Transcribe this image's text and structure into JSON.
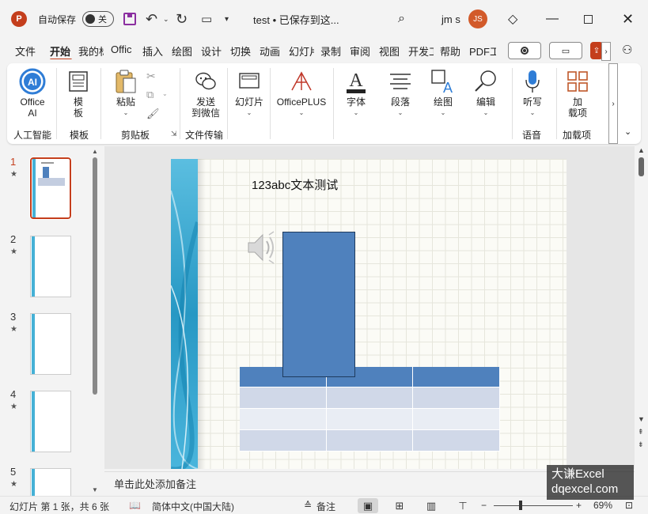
{
  "titlebar": {
    "app_logo": "P",
    "autosave_label": "自动保存",
    "toggle_state": "关",
    "doc_title": "test • 已保存到这...",
    "user_name": "jm s",
    "avatar_initials": "JS"
  },
  "tabs": [
    "文件",
    "开始",
    "我的标",
    "Offic",
    "插入",
    "绘图",
    "设计",
    "切换",
    "动画",
    "幻灯片",
    "录制",
    "审阅",
    "视图",
    "开发工",
    "帮助",
    "PDF工"
  ],
  "active_tab": "开始",
  "ribbon": {
    "office_ai": "Office\nAI",
    "office_ai_line1": "Office",
    "office_ai_line2": "AI",
    "template_line1": "模",
    "template_line2": "板",
    "paste": "粘贴",
    "send_line1": "发送",
    "send_line2": "到微信",
    "slides": "幻灯片",
    "officeplus": "OfficePLUS",
    "font": "字体",
    "paragraph": "段落",
    "drawing": "绘图",
    "editing": "编辑",
    "dictate": "听写",
    "addins_line1": "加",
    "addins_line2": "载项",
    "groups": {
      "ai": "人工智能",
      "template": "模板",
      "clipboard": "剪贴板",
      "file_transfer": "文件传输",
      "voice": "语音",
      "addins": "加载项"
    }
  },
  "thumbnails": [
    {
      "num": "1",
      "star": "★"
    },
    {
      "num": "2",
      "star": "★"
    },
    {
      "num": "3",
      "star": "★"
    },
    {
      "num": "4",
      "star": "★"
    },
    {
      "num": "5",
      "star": "★"
    }
  ],
  "slide": {
    "title_text": "123abc文本测试"
  },
  "notes_placeholder": "单击此处添加备注",
  "status": {
    "slide_info": "幻灯片 第 1 张，共 6 张",
    "language": "简体中文(中国大陆)",
    "notes_btn": "备注",
    "zoom_minus": "−",
    "zoom_plus": "+",
    "zoom_level": "69%"
  },
  "watermark": {
    "line1": "大谦Excel",
    "line2": "dqexcel.com"
  },
  "colors": {
    "accent": "#c43e1c",
    "table_header": "#4f81bd",
    "shape_fill": "#4f81bd"
  }
}
